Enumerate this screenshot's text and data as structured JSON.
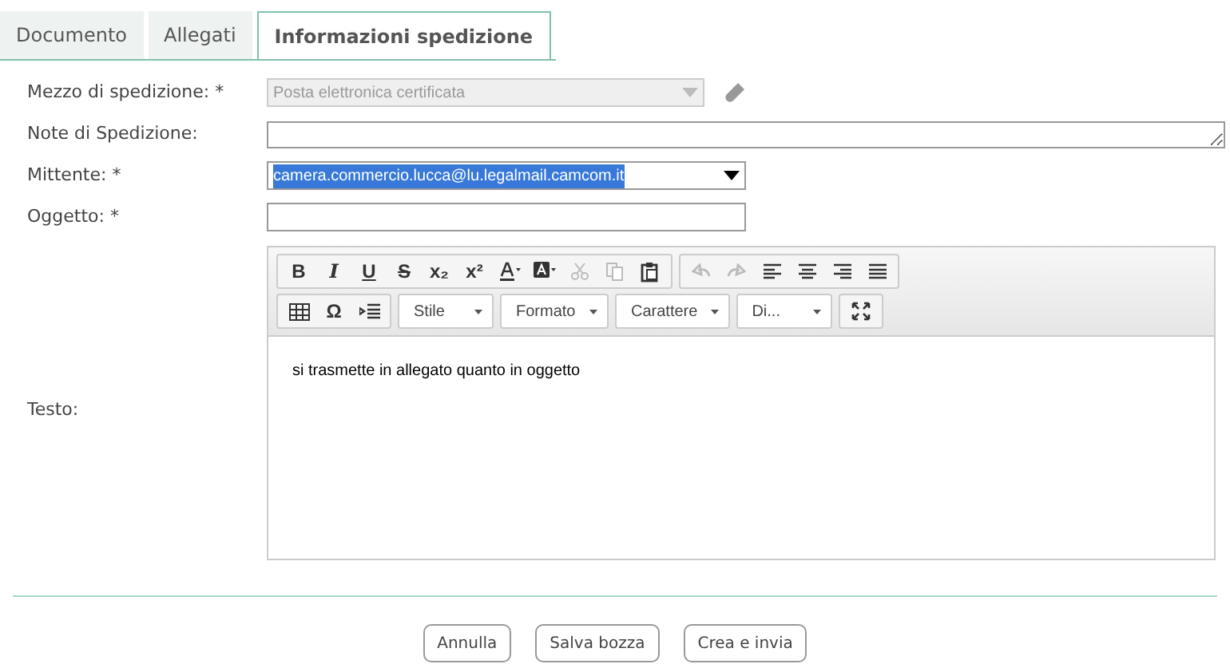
{
  "tabs": [
    {
      "label": "Documento",
      "selected": false
    },
    {
      "label": "Allegati",
      "selected": false
    },
    {
      "label": "Informazioni spedizione",
      "selected": true
    }
  ],
  "fields": [
    {
      "label": "Mezzo di spedizione: *",
      "kind": "select",
      "value": "Posta elettronica certificata",
      "disabled": true,
      "text_selected": false
    },
    {
      "label": "Note di Spedizione:",
      "kind": "textarea"
    },
    {
      "label": "Mittente: *",
      "kind": "select",
      "value": "camera.commercio.lucca@lu.legalmail.camcom.it",
      "disabled": false,
      "text_selected": true
    },
    {
      "label": "Oggetto: *",
      "kind": "input"
    }
  ],
  "editor": {
    "label": "Testo:",
    "toolbar_row_1": [
      [
        {
          "label": "B",
          "kind": "bold"
        },
        {
          "label": "I",
          "kind": "italic"
        },
        {
          "label": "U",
          "kind": "underline"
        },
        {
          "label": "S",
          "kind": "strike"
        },
        {
          "label": "x₂",
          "kind": "bold"
        },
        {
          "label": "x²",
          "kind": "bold"
        },
        {
          "kind": "icon",
          "disabled": false
        },
        {
          "kind": "icon",
          "disabled": false
        },
        {
          "kind": "icon",
          "disabled": true
        },
        {
          "kind": "icon",
          "disabled": true
        },
        {
          "kind": "icon",
          "disabled": false
        }
      ],
      [
        {
          "kind": "icon",
          "disabled": true
        },
        {
          "kind": "icon",
          "disabled": true
        },
        {
          "kind": "icon",
          "disabled": false
        },
        {
          "kind": "icon",
          "disabled": false
        },
        {
          "kind": "icon",
          "disabled": false
        },
        {
          "kind": "icon",
          "disabled": false
        }
      ]
    ],
    "toolbar_row_2": [
      {
        "kind": "group",
        "items": [
          {
            "kind": "icon",
            "disabled": false
          },
          {
            "label": "Ω",
            "kind": "bold"
          },
          {
            "kind": "icon",
            "disabled": false
          }
        ]
      },
      {
        "kind": "combo",
        "label": "Stile"
      },
      {
        "kind": "combo",
        "label": "Formato"
      },
      {
        "kind": "combo",
        "label": "Carattere"
      },
      {
        "kind": "combo",
        "label": "Di..."
      },
      {
        "kind": "group",
        "items": [
          {
            "kind": "icon",
            "disabled": false
          }
        ]
      }
    ],
    "content": "si trasmette in allegato quanto in oggetto"
  },
  "buttons": [
    "Annulla",
    "Salva bozza",
    "Crea e invia"
  ]
}
